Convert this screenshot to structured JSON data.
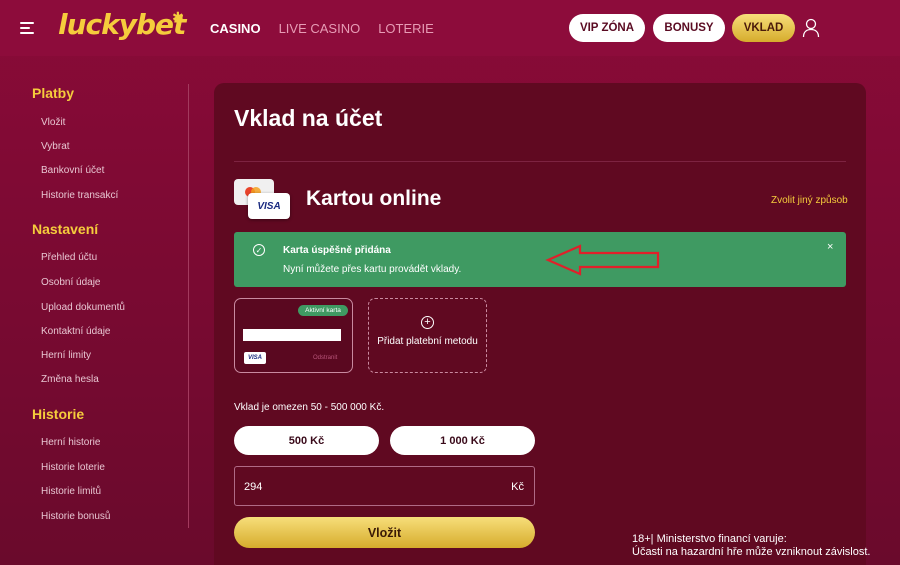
{
  "header": {
    "logo": "luckybet",
    "nav": [
      {
        "label": "CASINO",
        "active": true
      },
      {
        "label": "LIVE CASINO",
        "active": false
      },
      {
        "label": "LOTERIE",
        "active": false
      }
    ],
    "vip_label": "VIP ZÓNA",
    "bonusy_label": "BONUSY",
    "vklad_label": "VKLAD",
    "icons": {
      "menu": "hamburger-icon",
      "user": "user-icon"
    }
  },
  "sidebar": {
    "sections": [
      {
        "title": "Platby",
        "items": [
          "Vložit",
          "Vybrat",
          "Bankovní účet",
          "Historie transakcí"
        ]
      },
      {
        "title": "Nastavení",
        "items": [
          "Přehled účtu",
          "Osobní údaje",
          "Upload dokumentů",
          "Kontaktní údaje",
          "Herní limity",
          "Změna hesla"
        ]
      },
      {
        "title": "Historie",
        "items": [
          "Herní historie",
          "Historie loterie",
          "Historie limitů",
          "Historie bonusů"
        ]
      }
    ]
  },
  "main": {
    "title": "Vklad na účet",
    "method": {
      "title": "Kartou online",
      "change_link": "Zvolit jiný způsob",
      "card_logos": {
        "mastercard": "MasterCard",
        "visa": "VISA"
      }
    },
    "alert": {
      "title": "Karta úspěšně přidána",
      "text": "Nyní můžete přes kartu provádět vklady.",
      "close": "×"
    },
    "saved_card": {
      "badge": "Aktivní karta",
      "brand": "VISA",
      "remove": "Odstranit"
    },
    "add_method": {
      "label": "Přidat platební metodu"
    },
    "limit_text": "Vklad je omezen 50 - 500 000 Kč.",
    "amounts": [
      "500 Kč",
      "1 000 Kč"
    ],
    "amount_input": {
      "value": "294",
      "currency": "Kč"
    },
    "submit_label": "Vložit"
  },
  "disclaimer": {
    "line1": "18+| Ministerstvo financí varuje:",
    "line2": "Účasti na hazardní hře může vzniknout závislost."
  },
  "colors": {
    "brand_gold": "#f5cc3c",
    "background": "#7d0a33",
    "panel": "#600921",
    "success": "#3f9a62",
    "arrow": "#e0202a"
  }
}
